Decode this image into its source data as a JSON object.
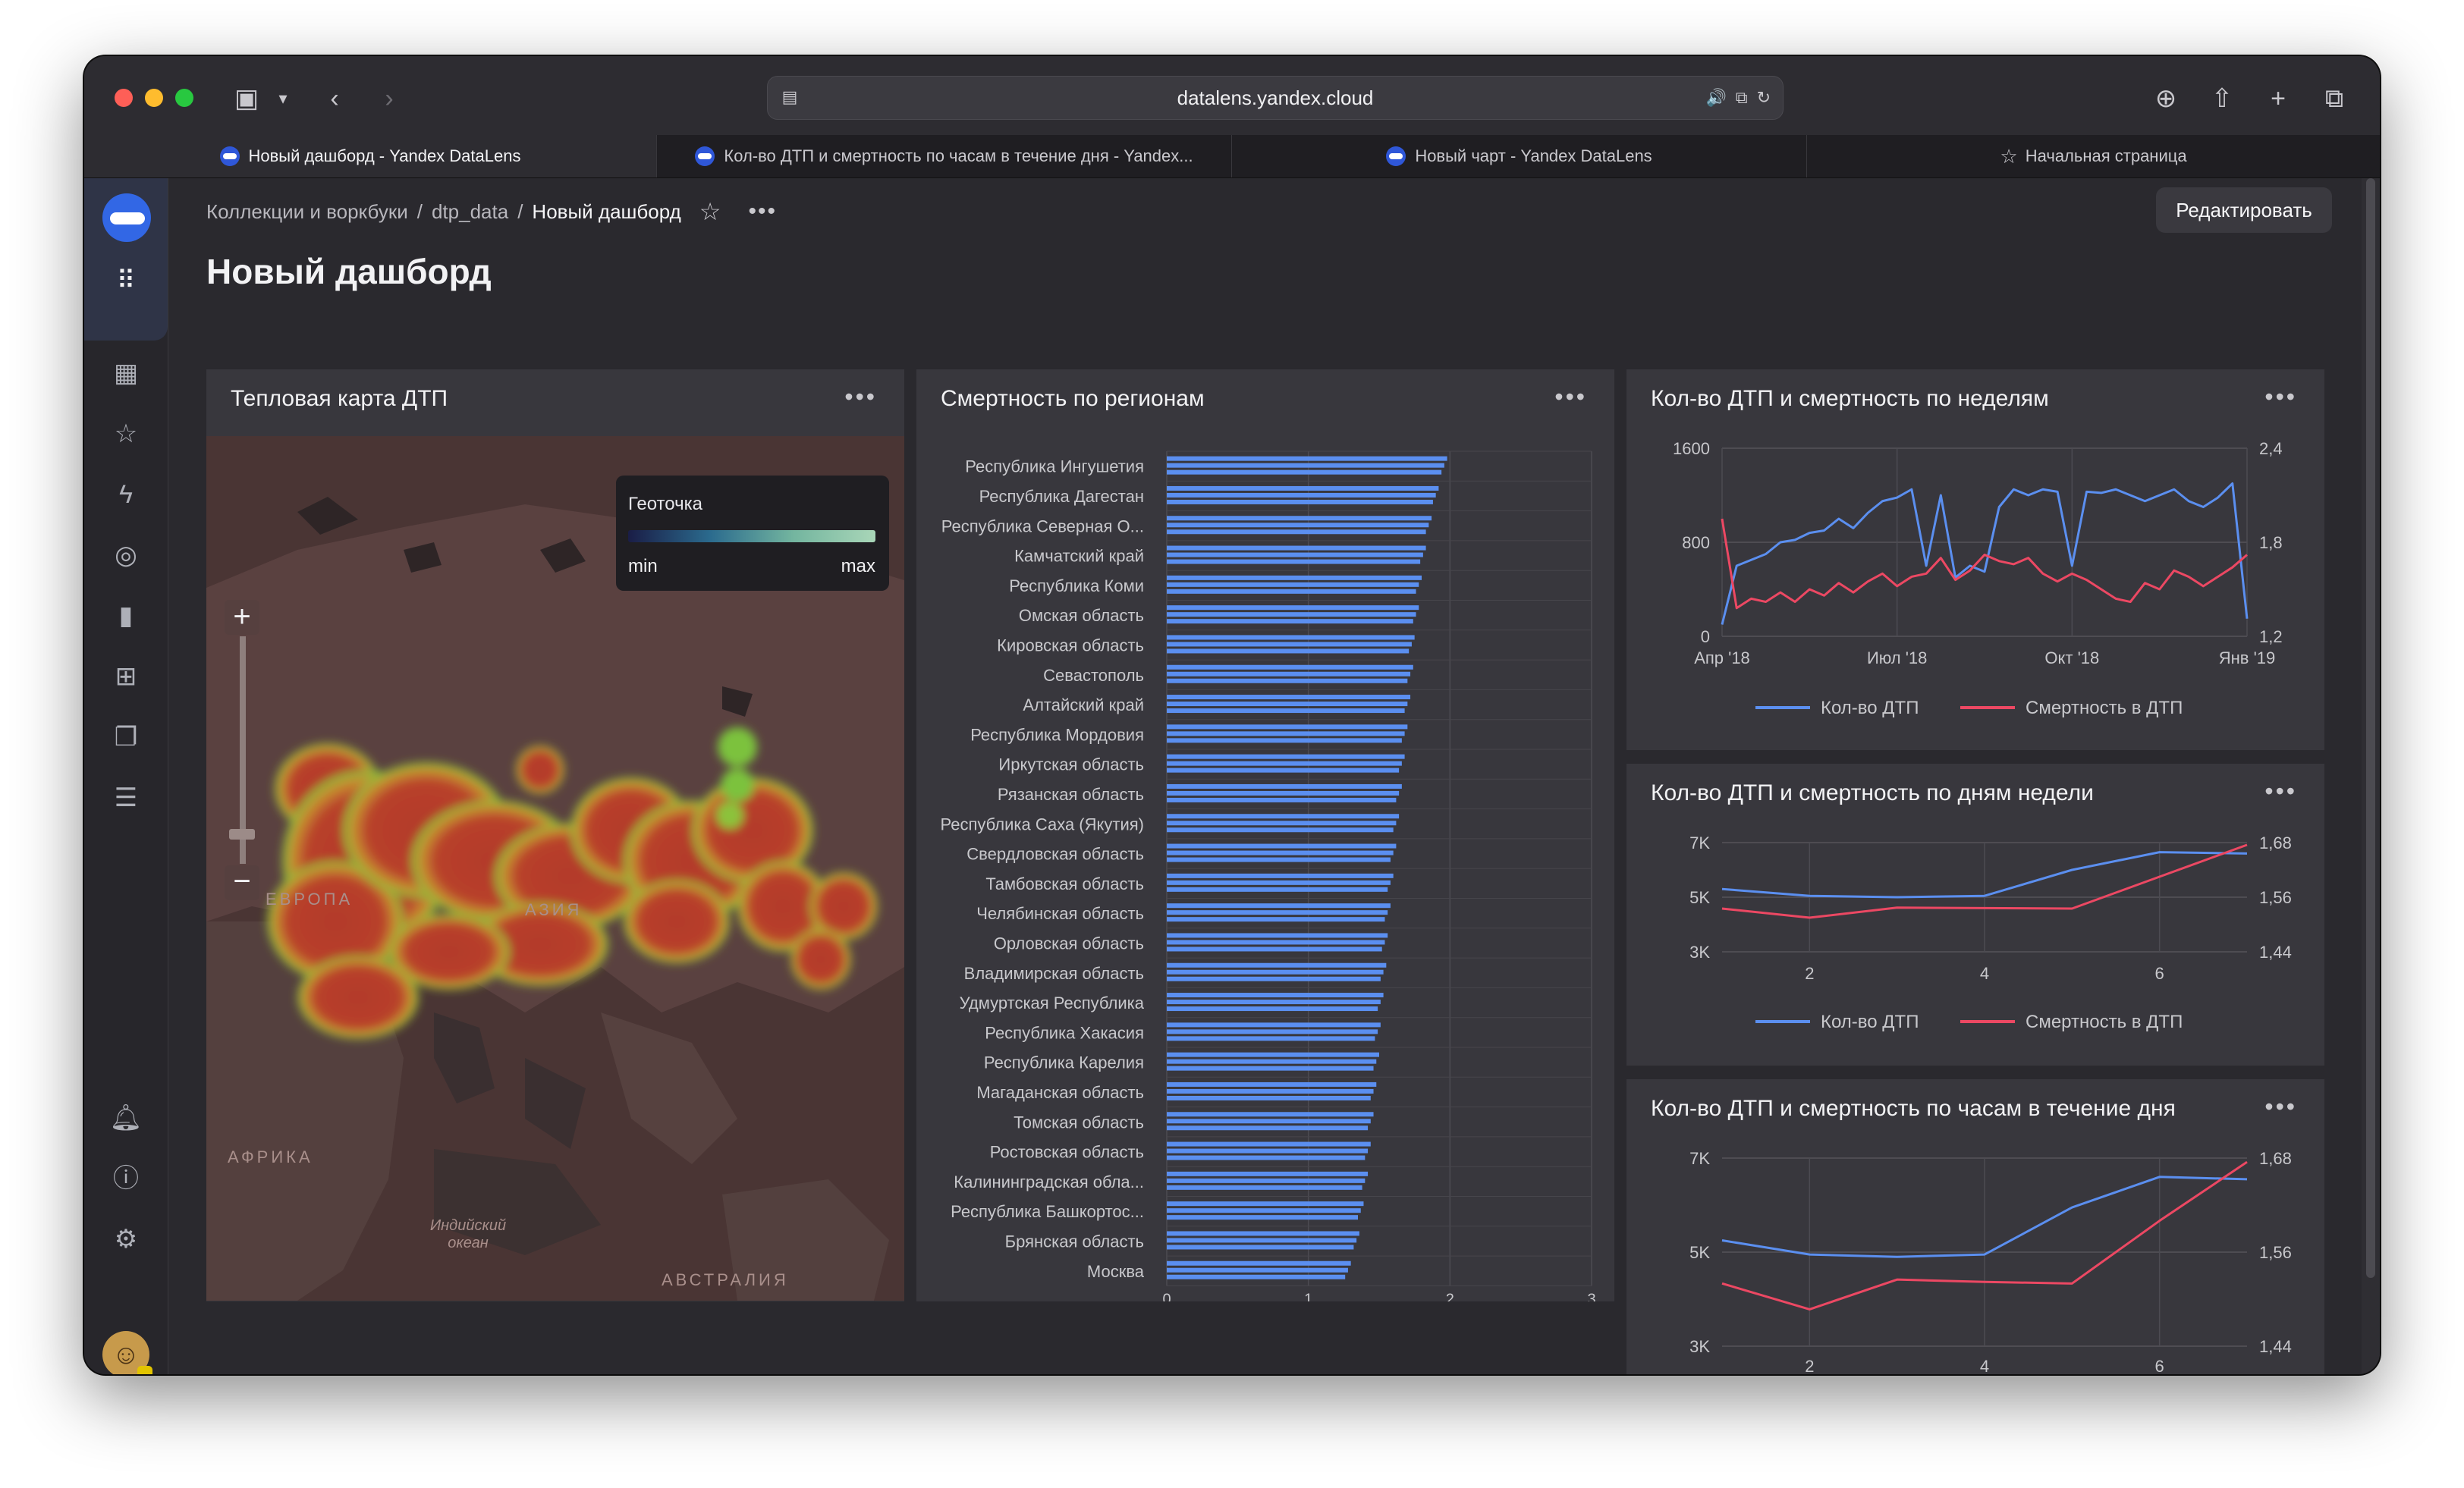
{
  "browser": {
    "url": "datalens.yandex.cloud",
    "tabs": [
      {
        "label": "Новый дашборд - Yandex DataLens"
      },
      {
        "label": "Кол-во ДТП и смертность по часам в течение дня - Yandex..."
      },
      {
        "label": "Новый чарт - Yandex DataLens"
      },
      {
        "label": "Начальная страница"
      }
    ]
  },
  "breadcrumbs": {
    "collections": "Коллекции и воркбуки",
    "folder": "dtp_data",
    "current": "Новый дашборд",
    "sep": "/"
  },
  "header": {
    "edit_label": "Редактировать",
    "title": "Новый дашборд"
  },
  "colors": {
    "series_a": "#5b8ff0",
    "series_b": "#ec4863",
    "bar": "#5b8ff0"
  },
  "map_widget": {
    "title": "Тепловая карта ДТП",
    "legend": {
      "title": "Геоточка",
      "min": "min",
      "max": "max"
    },
    "labels": {
      "africa": "АФРИКА",
      "australia": "АВСТРАЛИЯ",
      "ocean": "Индийский океан",
      "europe": "ЕВРОПА",
      "asia": "АЗИЯ"
    }
  },
  "bar_widget": {
    "title": "Смертность по регионам",
    "chart_data": {
      "type": "bar",
      "orientation": "horizontal",
      "xlim": [
        0,
        3
      ],
      "ticks": [
        "0",
        "1",
        "2",
        "3"
      ],
      "categories": [
        "Республика Ингушетия",
        "Республика Дагестан",
        "Республика Северная О...",
        "Камчатский край",
        "Республика Коми",
        "Омская область",
        "Кировская область",
        "Севастополь",
        "Алтайский край",
        "Республика Мордовия",
        "Иркутская область",
        "Рязанская область",
        "Республика Саха (Якутия)",
        "Свердловская область",
        "Тамбовская область",
        "Челябинская область",
        "Орловская область",
        "Владимирская область",
        "Удмуртская Республика",
        "Республика Хакасия",
        "Республика Карелия",
        "Магаданская область",
        "Томская область",
        "Ростовская область",
        "Калининградская обла...",
        "Республика Башкортос...",
        "Брянская область",
        "Москва"
      ],
      "values": [
        1.98,
        1.92,
        1.87,
        1.83,
        1.8,
        1.78,
        1.75,
        1.74,
        1.72,
        1.7,
        1.68,
        1.66,
        1.64,
        1.62,
        1.6,
        1.58,
        1.56,
        1.55,
        1.53,
        1.51,
        1.5,
        1.48,
        1.46,
        1.44,
        1.42,
        1.39,
        1.36,
        1.3
      ]
    }
  },
  "weekly_widget": {
    "title": "Кол-во ДТП и смертность по неделям",
    "chart_data": {
      "type": "line",
      "x_ticks": [
        "Апр '18",
        "Июл '18",
        "Окт '18",
        "Янв '19"
      ],
      "y_ticks": [
        "0",
        "800",
        "1600"
      ],
      "y2_ticks": [
        "1,2",
        "1,8",
        "2,4"
      ],
      "ylim": [
        0,
        1600
      ],
      "y2lim": [
        1.2,
        2.4
      ],
      "series": [
        {
          "name": "Кол-во ДТП",
          "values": [
            100,
            600,
            650,
            700,
            800,
            820,
            880,
            900,
            1000,
            920,
            1050,
            1150,
            1180,
            1250,
            600,
            1200,
            500,
            600,
            550,
            1100,
            1250,
            1200,
            1250,
            1230,
            600,
            1230,
            1220,
            1250,
            1200,
            1150,
            1200,
            1250,
            1150,
            1100,
            1180,
            1300,
            150
          ]
        },
        {
          "name": "Смертность в ДТП",
          "values": [
            1.95,
            1.38,
            1.44,
            1.42,
            1.48,
            1.42,
            1.5,
            1.46,
            1.54,
            1.48,
            1.55,
            1.6,
            1.52,
            1.58,
            1.6,
            1.7,
            1.56,
            1.62,
            1.72,
            1.68,
            1.66,
            1.7,
            1.6,
            1.55,
            1.6,
            1.56,
            1.5,
            1.44,
            1.42,
            1.54,
            1.5,
            1.62,
            1.58,
            1.52,
            1.58,
            1.64,
            1.72
          ]
        }
      ]
    }
  },
  "dow_widget": {
    "title": "Кол-во ДТП и смертность по дням недели",
    "chart_data": {
      "type": "line",
      "x": [
        1,
        2,
        3,
        4,
        5,
        6,
        7
      ],
      "x_ticks": [
        "2",
        "4",
        "6"
      ],
      "y_ticks": [
        "3K",
        "5K",
        "7K"
      ],
      "y2_ticks": [
        "1,44",
        "1,56",
        "1,68"
      ],
      "ylim": [
        3000,
        7000
      ],
      "y2lim": [
        1.44,
        1.68
      ],
      "series": [
        {
          "name": "Кол-во ДТП",
          "values": [
            5300,
            5050,
            5000,
            5050,
            6000,
            6650,
            6600
          ]
        },
        {
          "name": "Смертность в ДТП",
          "values": [
            1.535,
            1.515,
            1.537,
            1.536,
            1.535,
            1.605,
            1.675
          ]
        }
      ]
    }
  },
  "hour_widget": {
    "title": "Кол-во ДТП и смертность по часам в течение дня",
    "chart_data": {
      "type": "line",
      "x": [
        1,
        2,
        3,
        4,
        5,
        6,
        7
      ],
      "x_ticks": [
        "2",
        "4",
        "6"
      ],
      "y_ticks": [
        "3K",
        "5K",
        "7K"
      ],
      "y2_ticks": [
        "1,44",
        "1,56",
        "1,68"
      ],
      "ylim": [
        3000,
        7000
      ],
      "y2lim": [
        1.44,
        1.68
      ],
      "series": [
        {
          "name": "Кол-во ДТП",
          "values": [
            5250,
            4950,
            4900,
            4950,
            5950,
            6600,
            6550
          ]
        },
        {
          "name": "Смертность в ДТП",
          "values": [
            1.52,
            1.487,
            1.525,
            1.522,
            1.52,
            1.6,
            1.675
          ]
        }
      ]
    }
  }
}
